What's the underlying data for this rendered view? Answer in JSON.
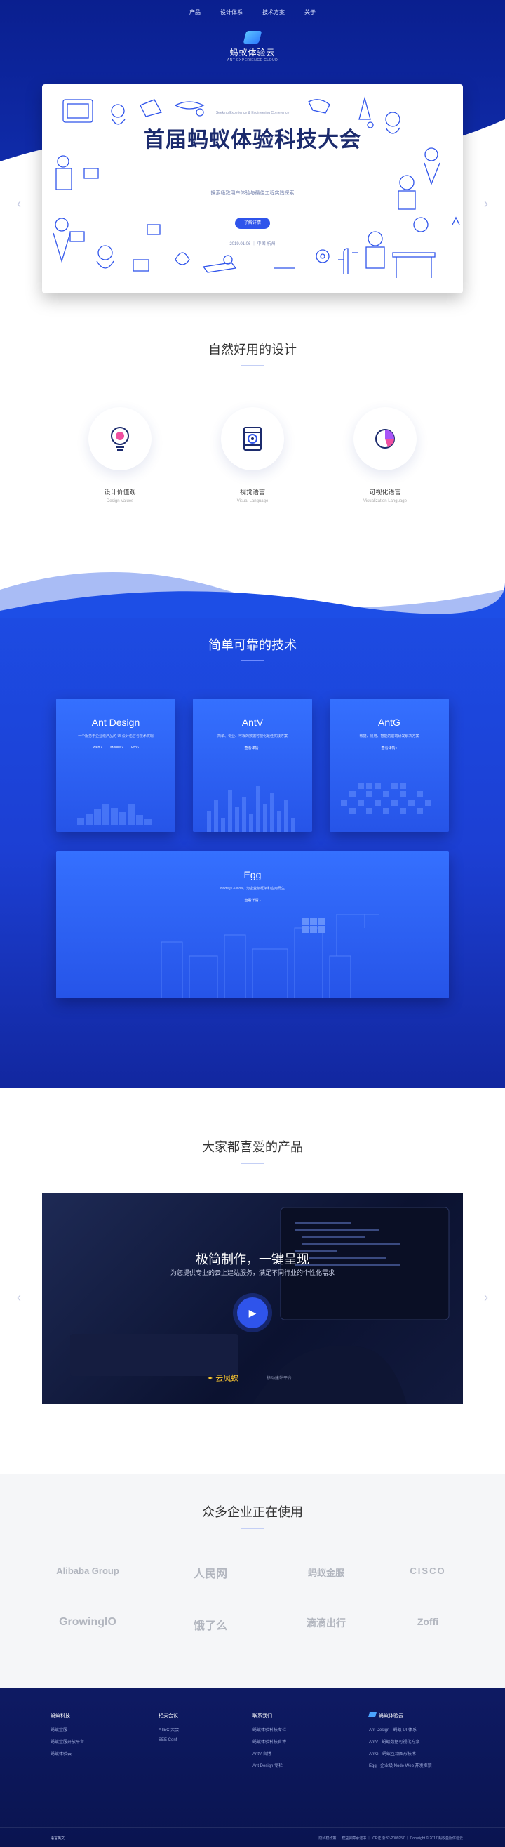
{
  "nav": {
    "items": [
      "产品",
      "设计体系",
      "技术方案",
      "关于"
    ]
  },
  "logo": {
    "name": "蚂蚁体验云",
    "sub": "ANT EXPERIENCE CLOUD"
  },
  "hero": {
    "small": "Seeking Experience & Engineering Conference",
    "title": "首届蚂蚁体验科技大会",
    "desc": "探索极致用户体验与最佳工程实践探索",
    "button": "了解详情",
    "date": "2019.01.06 ｜ 中国·杭州"
  },
  "design": {
    "title": "自然好用的设计",
    "features": [
      {
        "label": "设计价值观",
        "en": "Design Values",
        "icon": "lightbulb-icon"
      },
      {
        "label": "视觉语言",
        "en": "Visual Language",
        "icon": "document-eye-icon"
      },
      {
        "label": "可视化语言",
        "en": "Visualization Language",
        "icon": "pie-chart-icon"
      }
    ]
  },
  "tech": {
    "title": "简单可靠的技术",
    "cards": [
      {
        "title": "Ant Design",
        "desc": "一个服务于企业级产品的 UI 设计语言与技术实现",
        "links": [
          "Web ›",
          "Mobile ›",
          "Pro ›"
        ]
      },
      {
        "title": "AntV",
        "desc": "简单、专业、可靠的数据可视化最佳实践方案",
        "links": [
          "查看详情 ›"
        ]
      },
      {
        "title": "AntG",
        "desc": "敏捷、易用、智能的前端研发解决方案",
        "links": [
          "查看详情 ›"
        ]
      },
      {
        "title": "Egg",
        "desc": "Node.js & Koa，为企业级框架和应用而生",
        "links": [
          "查看详情 ›"
        ]
      }
    ]
  },
  "products": {
    "title": "大家都喜爱的产品",
    "video_title": "极简制作，一键呈现",
    "video_sub": "为您提供专业的云上建站服务，满足不同行业的个性化需求",
    "brand": "云凤蝶",
    "brand_sub": "移动建站平台"
  },
  "clients": {
    "title": "众多企业正在使用",
    "logos": [
      "Alibaba Group",
      "人民网",
      "蚂蚁金服",
      "CISCO",
      "GrowingIO",
      "饿了么",
      "滴滴出行",
      "Zoffi"
    ]
  },
  "footer": {
    "cols": [
      {
        "h": "蚂蚁科技",
        "items": [
          "蚂蚁金服",
          "蚂蚁金服开放平台",
          "蚂蚁体验云"
        ]
      },
      {
        "h": "相关会议",
        "items": [
          "ATEC 大会",
          "SEE Conf"
        ]
      },
      {
        "h": "联系我们",
        "items": [
          "蚂蚁体验科技专栏",
          "蚂蚁体验科技官博",
          "AntV 官博",
          "Ant Design 专栏"
        ]
      },
      {
        "h": "蚂蚁体验云",
        "items": [
          "Ant Design - 蚂蚁 UI 体系",
          "AntV - 蚂蚁数据可视化方案",
          "AntG - 蚂蚁互动图形技术",
          "Egg - 企业级 Node Web 开发框架"
        ]
      }
    ],
    "left": "语言英文",
    "right": "隐私权政策 ｜ 权益保障承诺书 ｜ ICP证 浙B2-2009257 ｜ Copyright © 2017 蚂蚁金服体验云"
  },
  "colors": {
    "primary": "#2f54eb",
    "hero": "#0a1f8f"
  }
}
